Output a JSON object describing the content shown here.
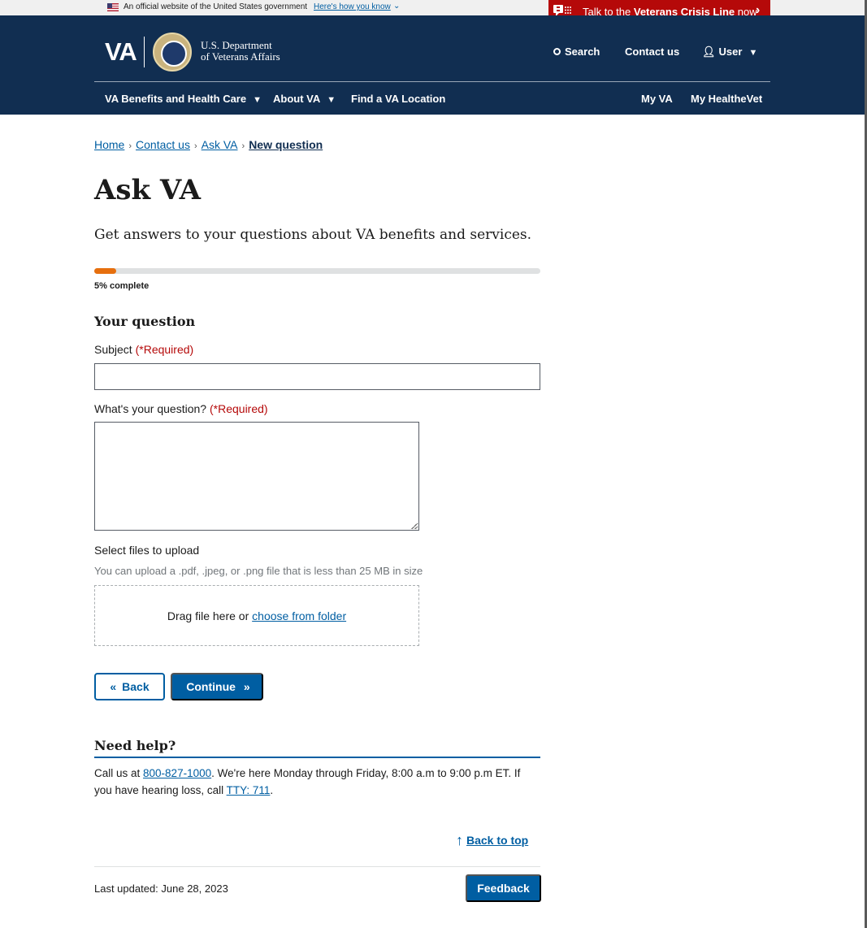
{
  "gov_banner": {
    "official_text": "An official website of the United States government",
    "how_link": "Here's how you know"
  },
  "crisis_line": {
    "prefix": "Talk to the ",
    "bold": "Veterans Crisis Line",
    "suffix": " now"
  },
  "header": {
    "logo_va": "VA",
    "dept_line1": "U.S. Department",
    "dept_line2": "of Veterans Affairs",
    "search": "Search",
    "contact": "Contact us",
    "user": "User"
  },
  "nav": {
    "benefits": "VA Benefits and Health Care",
    "about": "About VA",
    "find": "Find a VA Location",
    "myva": "My VA",
    "healthevet": "My HealtheVet"
  },
  "breadcrumb": {
    "home": "Home",
    "contact": "Contact us",
    "ask": "Ask VA",
    "current": "New question"
  },
  "page": {
    "title": "Ask VA",
    "intro": "Get answers to your questions about VA benefits and services."
  },
  "progress": {
    "percent": 5,
    "label": "5% complete"
  },
  "form": {
    "section_title": "Your question",
    "subject_label": "Subject",
    "required": "(*Required)",
    "subject_value": "",
    "question_label": "What's your question?",
    "question_value": "",
    "files_label": "Select files to upload",
    "files_hint": "You can upload a .pdf, .jpeg, or .png file that is less than 25 MB in size",
    "drop_text": "Drag file here or ",
    "choose_link": "choose from folder",
    "back": "Back",
    "continue": "Continue"
  },
  "help": {
    "title": "Need help?",
    "text1": "Call us at ",
    "phone": "800-827-1000",
    "text2": ". We're here Monday through Friday, 8:00 a.m to 9:00 p.m ET. If you have hearing loss, call ",
    "tty": "TTY: 711",
    "text3": "."
  },
  "footer": {
    "back_to_top": "Back to top",
    "last_updated": "Last updated: June 28, 2023",
    "feedback": "Feedback"
  },
  "colors": {
    "header_bg": "#112e51",
    "crisis_bg": "#b50909",
    "primary": "#005ea2",
    "progress": "#e66f0e",
    "required": "#b50909"
  }
}
